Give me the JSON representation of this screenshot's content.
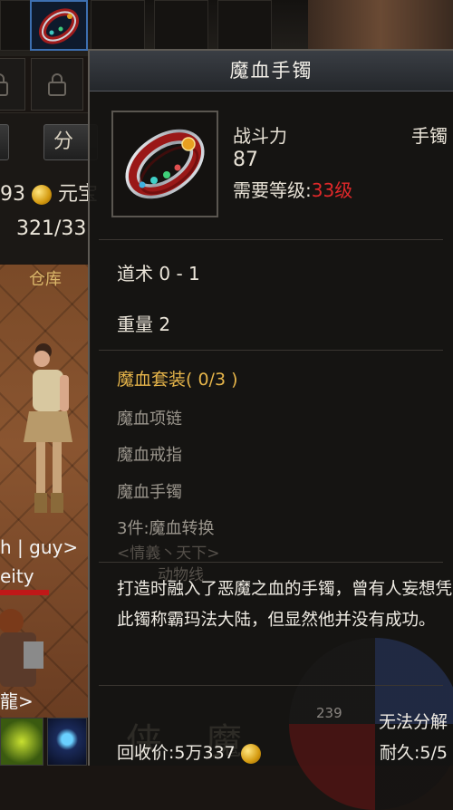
{
  "background": {
    "left_panel": {
      "button_label": "分",
      "money_amount": "93",
      "money_suffix": "元宝",
      "capacity": "321/33",
      "warehouse_tab": "仓库"
    },
    "player": {
      "name": "h | guy>",
      "title": "eity",
      "guild": "龍>"
    }
  },
  "tooltip": {
    "title": "魔血手镯",
    "icon": "bracelet-icon",
    "combat_power_label": "战斗力",
    "combat_power_value": "87",
    "item_type": "手镯",
    "required_level_label": "需要等级:",
    "required_level_value": "33级",
    "attributes": [
      "道术 0 - 1",
      "重量 2"
    ],
    "set": {
      "title": "魔血套装( 0/3 )",
      "pieces": [
        "魔血项链",
        "魔血戒指",
        "魔血手镯"
      ],
      "bonus": "3件:魔血转换"
    },
    "description": "打造时融入了恶魔之血的手镯，曾有人妄想凭此镯称霸玛法大陆，但显然他并没有成功。",
    "decompose_status": "无法分解",
    "recycle_label": "回收价:",
    "recycle_value": "5万337",
    "durability_label": "耐久:",
    "durability_value": "5/5",
    "background_number": "239",
    "ghost_text_1": "<情義丶天下>",
    "ghost_text_2": "动物线",
    "ghost_big_1": "侠",
    "ghost_big_2": "魔"
  },
  "colors": {
    "set_title": "#e6b54a",
    "required_level": "#e0282a",
    "header_bg": "#2e3136"
  }
}
